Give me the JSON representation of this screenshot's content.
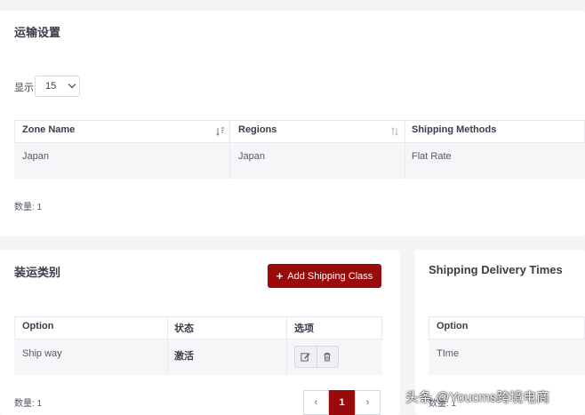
{
  "shipping_settings": {
    "title": "运输设置",
    "show_label": "显示",
    "page_size": "15",
    "columns": [
      "Zone Name",
      "Regions",
      "Shipping Methods"
    ],
    "rows": [
      {
        "zone_name": "Japan",
        "regions": "Japan",
        "shipping_methods": "Flat Rate"
      }
    ],
    "count_label": "数量: 1"
  },
  "shipping_classes": {
    "title": "装运类别",
    "add_button_label": "Add Shipping Class",
    "columns": [
      "Option",
      "状态",
      "选项"
    ],
    "rows": [
      {
        "option": "Ship way",
        "status": "激活"
      }
    ],
    "count_label": "数量: 1",
    "pagination": {
      "prev": "‹",
      "current": "1",
      "next": "›"
    }
  },
  "delivery_times": {
    "title": "Shipping Delivery Times",
    "columns": [
      "Option"
    ],
    "rows": [
      {
        "option": "TIme"
      }
    ],
    "count_label": "数量: 1"
  },
  "watermark": "头条 @Youcms跨境电商",
  "icons": {
    "sort": "sort-icon",
    "edit": "edit-icon",
    "delete": "trash-icon",
    "add": "plus-icon"
  },
  "colors": {
    "accent": "#9b0a0a",
    "background": "#f4f5f7"
  }
}
